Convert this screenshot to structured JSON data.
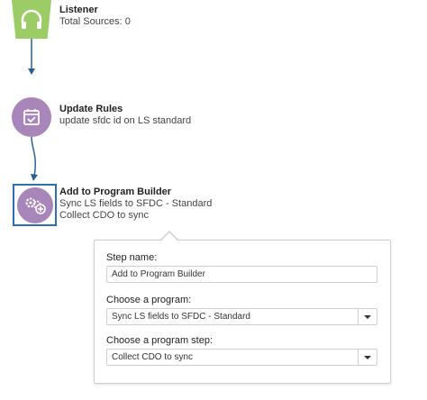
{
  "steps": [
    {
      "title": "Listener",
      "lines": [
        "Total Sources: 0"
      ]
    },
    {
      "title": "Update Rules",
      "lines": [
        "update sfdc id on LS standard"
      ]
    },
    {
      "title": "Add to Program Builder",
      "lines": [
        "Sync LS fields to SFDC - Standard",
        "Collect CDO to sync"
      ]
    }
  ],
  "panel": {
    "step_name_label": "Step name:",
    "step_name_value": "Add to Program Builder",
    "program_label": "Choose a program:",
    "program_value": "Sync LS fields to SFDC - Standard",
    "program_step_label": "Choose a program step:",
    "program_step_value": "Collect CDO to sync"
  },
  "icons": {
    "listener": "headphones-icon",
    "update_rules": "calendar-check-icon",
    "program_builder": "gears-add-icon",
    "dropdown": "chevron-down-icon"
  },
  "colors": {
    "listener": "#9ccc65",
    "node": "#a886b9",
    "connector": "#2c5f8f",
    "selection": "#2c6fb5"
  }
}
